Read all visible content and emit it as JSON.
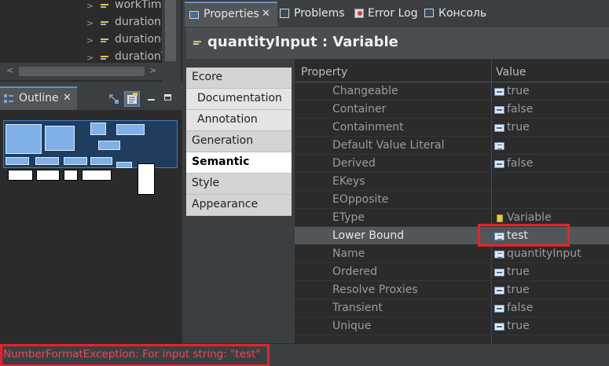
{
  "tree": {
    "items": [
      {
        "label": "workTime"
      },
      {
        "label": "durationI"
      },
      {
        "label": "durationC"
      },
      {
        "label": "durationT"
      }
    ]
  },
  "outline": {
    "tab_label": "Outline",
    "close_glyph": "✕"
  },
  "view_tabs": [
    {
      "label": "Properties",
      "icon": "properties-icon",
      "close_glyph": "✕"
    },
    {
      "label": "Problems",
      "icon": "problems-icon"
    },
    {
      "label": "Error Log",
      "icon": "error-log-icon"
    },
    {
      "label": "Консоль",
      "icon": "console-icon"
    }
  ],
  "properties": {
    "title": "quantityInput : Variable",
    "tabs": [
      {
        "label": "Ecore",
        "selected": false,
        "sub": false
      },
      {
        "label": "Documentation",
        "selected": false,
        "sub": true
      },
      {
        "label": "Annotation",
        "selected": false,
        "sub": true
      },
      {
        "label": "Generation",
        "selected": false,
        "sub": false
      },
      {
        "label": "Semantic",
        "selected": true,
        "sub": false
      },
      {
        "label": "Style",
        "selected": false,
        "sub": false
      },
      {
        "label": "Appearance",
        "selected": false,
        "sub": false
      }
    ],
    "columns": {
      "property": "Property",
      "value": "Value"
    },
    "rows": [
      {
        "name": "Changeable",
        "value": "true",
        "icon": "bool"
      },
      {
        "name": "Container",
        "value": "false",
        "icon": "bool"
      },
      {
        "name": "Containment",
        "value": "true",
        "icon": "bool"
      },
      {
        "name": "Default Value Literal",
        "value": "",
        "icon": "txt"
      },
      {
        "name": "Derived",
        "value": "false",
        "icon": "bool"
      },
      {
        "name": "EKeys",
        "value": "",
        "icon": ""
      },
      {
        "name": "EOpposite",
        "value": "",
        "icon": ""
      },
      {
        "name": "EType",
        "value": "Variable",
        "icon": "cls"
      },
      {
        "name": "Lower Bound",
        "value": "test",
        "icon": "txt",
        "selected": true
      },
      {
        "name": "Name",
        "value": "quantityInput",
        "icon": "txt"
      },
      {
        "name": "Ordered",
        "value": "true",
        "icon": "bool"
      },
      {
        "name": "Resolve Proxies",
        "value": "true",
        "icon": "bool"
      },
      {
        "name": "Transient",
        "value": "false",
        "icon": "bool"
      },
      {
        "name": "Unique",
        "value": "true",
        "icon": "bool"
      }
    ]
  },
  "status": {
    "message": "NumberFormatException: For input string: \"test\""
  },
  "colors": {
    "highlight": "#e8212c",
    "error_text": "#e24b55"
  }
}
